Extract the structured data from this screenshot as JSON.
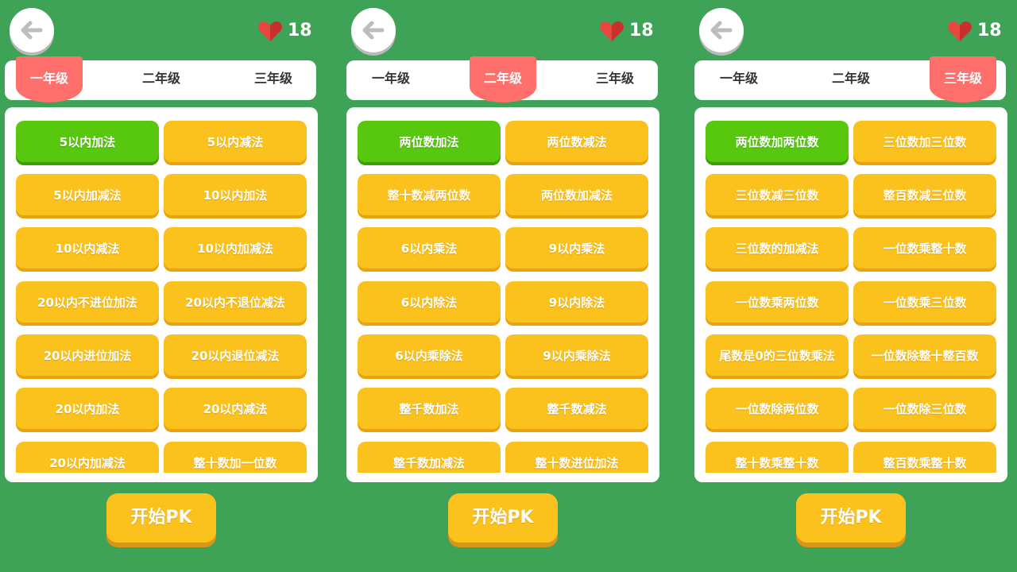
{
  "colors": {
    "background": "#3ea357",
    "active_tab": "#ff6f6b",
    "operation_button": "#fbc21d",
    "selected_operation": "#57c80d",
    "heart": "#e9463f"
  },
  "icons": {
    "back": "left-arrow-icon",
    "heart": "heart-icon"
  },
  "panels": [
    {
      "hearts": "18",
      "tabs": [
        "一年级",
        "二年级",
        "三年级"
      ],
      "active_tab": 0,
      "selected_operation": 0,
      "operations": [
        "5以内加法",
        "5以内减法",
        "5以内加减法",
        "10以内加法",
        "10以内减法",
        "10以内加减法",
        "20以内不进位加法",
        "20以内不退位减法",
        "20以内进位加法",
        "20以内退位减法",
        "20以内加法",
        "20以内减法",
        "20以内加减法",
        "整十数加一位数"
      ],
      "start_label": "开始PK"
    },
    {
      "hearts": "18",
      "tabs": [
        "一年级",
        "二年级",
        "三年级"
      ],
      "active_tab": 1,
      "selected_operation": 0,
      "operations": [
        "两位数加法",
        "两位数减法",
        "整十数减两位数",
        "两位数加减法",
        "6以内乘法",
        "9以内乘法",
        "6以内除法",
        "9以内除法",
        "6以内乘除法",
        "9以内乘除法",
        "整千数加法",
        "整千数减法",
        "整千数加减法",
        "整十数进位加法"
      ],
      "start_label": "开始PK"
    },
    {
      "hearts": "18",
      "tabs": [
        "一年级",
        "二年级",
        "三年级"
      ],
      "active_tab": 2,
      "selected_operation": 0,
      "operations": [
        "两位数加两位数",
        "三位数加三位数",
        "三位数减三位数",
        "整百数减三位数",
        "三位数的加减法",
        "一位数乘整十数",
        "一位数乘两位数",
        "一位数乘三位数",
        "尾数是0的三位数乘法",
        "一位数除整十整百数",
        "一位数除两位数",
        "一位数除三位数",
        "整十数乘整十数",
        "整百数乘整十数"
      ],
      "start_label": "开始PK"
    }
  ]
}
